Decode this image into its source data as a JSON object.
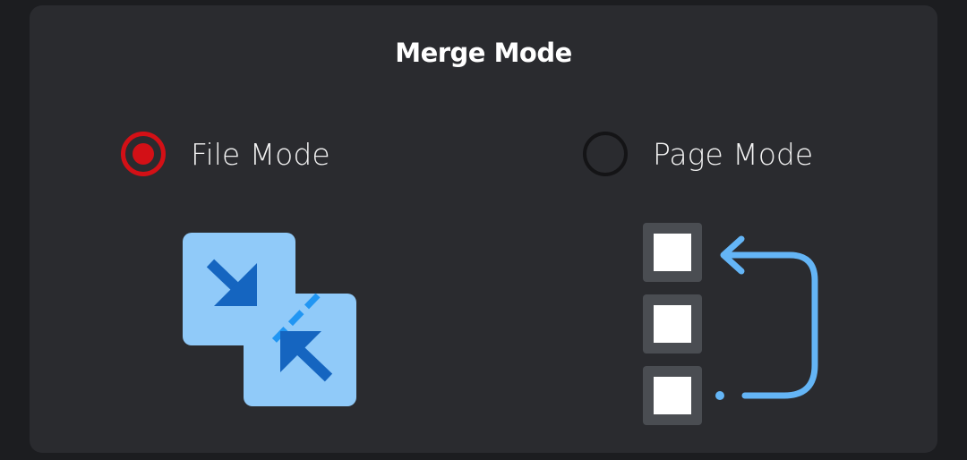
{
  "dialog": {
    "title": "Merge Mode",
    "options": [
      {
        "label": "File Mode",
        "selected": true,
        "illustration": "merge-arrows-icon"
      },
      {
        "label": "Page Mode",
        "selected": false,
        "illustration": "page-reorder-icon"
      }
    ]
  },
  "colors": {
    "accent": "#d31016",
    "icon_light_blue": "#90caf9",
    "icon_dark_blue": "#1565c0",
    "icon_mid_blue": "#64b5f6"
  }
}
